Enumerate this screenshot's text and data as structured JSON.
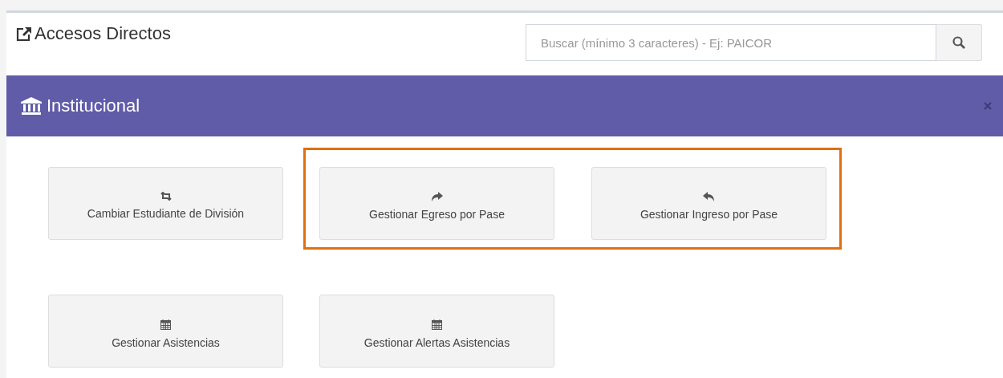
{
  "header": {
    "title": "Accesos Directos",
    "search": {
      "placeholder": "Buscar (mínimo 3 caracteres) - Ej: PAICOR"
    }
  },
  "section": {
    "title": "Institucional",
    "rows": [
      {
        "items": [
          {
            "label": "Cambiar Estudiante de División",
            "kind": "swap",
            "highlighted": false
          },
          {
            "label": "Gestionar Egreso por Pase",
            "kind": "forward",
            "highlighted": true
          },
          {
            "label": "Gestionar Ingreso por Pase",
            "kind": "back",
            "highlighted": true
          }
        ]
      },
      {
        "items": [
          {
            "label": "Gestionar Asistencias",
            "kind": "calendar",
            "highlighted": false
          },
          {
            "label": "Gestionar Alertas Asistencias",
            "kind": "calendar",
            "highlighted": false
          }
        ]
      }
    ]
  }
}
